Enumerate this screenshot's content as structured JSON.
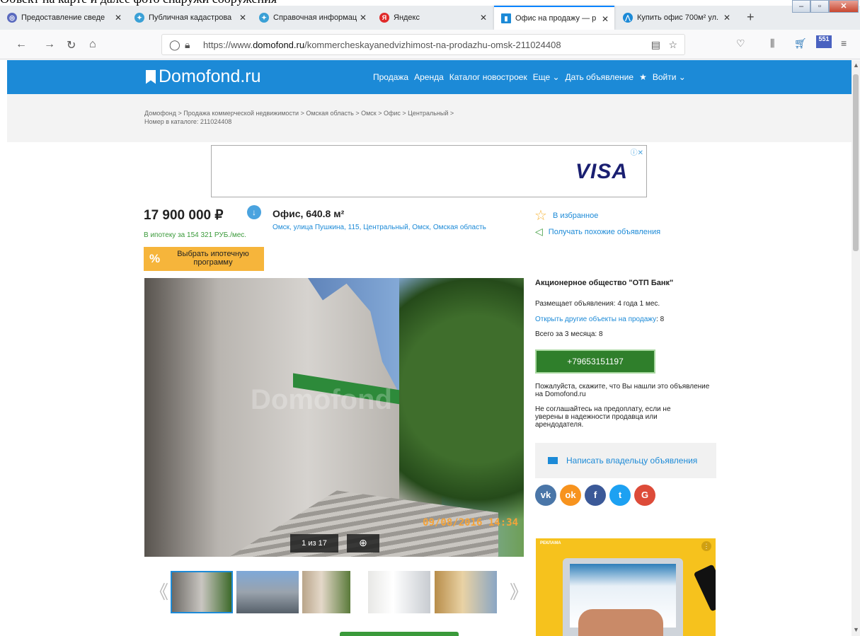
{
  "browser": {
    "caption_partial": "Объект на карте и далее фото снаружи сооружения",
    "tabs": [
      {
        "label": "Предоставление сведе",
        "color": "#5b6bbf"
      },
      {
        "label": "Публичная кадастрова",
        "color": "#3aa0d6"
      },
      {
        "label": "Справочная информац",
        "color": "#3aa0d6"
      },
      {
        "label": "Яндекс",
        "color": "#e02a2a"
      },
      {
        "label": "Офис на продажу — р",
        "color": "#1c8ad7"
      },
      {
        "label": "Купить офис 700м² ул.",
        "color": "#1c8ad7"
      }
    ],
    "url_prefix": "https://www.",
    "url_domain": "domofond.ru",
    "url_path": "/kommercheskayanedvizhimost-na-prodazhu-omsk-211024408",
    "badge_count": "551"
  },
  "site": {
    "logo": "Domofond.ru",
    "nav": [
      "Продажа",
      "Аренда",
      "Каталог новостроек",
      "Еще ⌄",
      "Дать объявление",
      "★",
      "Войти ⌄"
    ]
  },
  "breadcrumb": {
    "line1": "Домофонд > Продажа коммерческой недвижимости > Омская область > Омск > Офис > Центральный >",
    "line2": "Номер в каталоге: 211024408"
  },
  "ad": {
    "brand": "VISA",
    "adchoice": "ⓘ✕"
  },
  "listing": {
    "price": "17 900 000 ₽",
    "mortgage": "В ипотеку за 154 321 РУБ./мес.",
    "mortgage_button": "Выбрать ипотечную программу",
    "title": "Офис, 640.8 м²",
    "address": "Омск, улица Пушкина, 115, Центральный, Омск, Омская область",
    "favorite": "В избранное",
    "similar": "Получать похожие объявления",
    "photo_counter": "1 из 17",
    "photo_date": "09/08/2016 14:34",
    "photo_watermark": "Domofond"
  },
  "seller": {
    "name": "Акционерное общество \"ОТП Банк\"",
    "period": "Размещает объявления: 4 года 1 мес.",
    "others_link": "Открыть другие объекты на продажу",
    "others_count": ": 8",
    "total": "Всего за 3 месяца: 8",
    "phone": "+79653151197",
    "say_found": "Пожалуйста, скажите, что Вы нашли это объявление на Domofond.ru",
    "warning": "Не соглашайтесь на предоплату, если не уверены в надежности продавца или арендодателя.",
    "write_owner": "Написать владельцу объявления"
  },
  "socials": [
    {
      "label": "vk",
      "color": "#4a76a8"
    },
    {
      "label": "ok",
      "color": "#f7931e"
    },
    {
      "label": "f",
      "color": "#3b5998"
    },
    {
      "label": "t",
      "color": "#1da1f2"
    },
    {
      "label": "G",
      "color": "#dd4b39"
    }
  ],
  "right_ad": {
    "label": "РЕКЛАМА"
  }
}
